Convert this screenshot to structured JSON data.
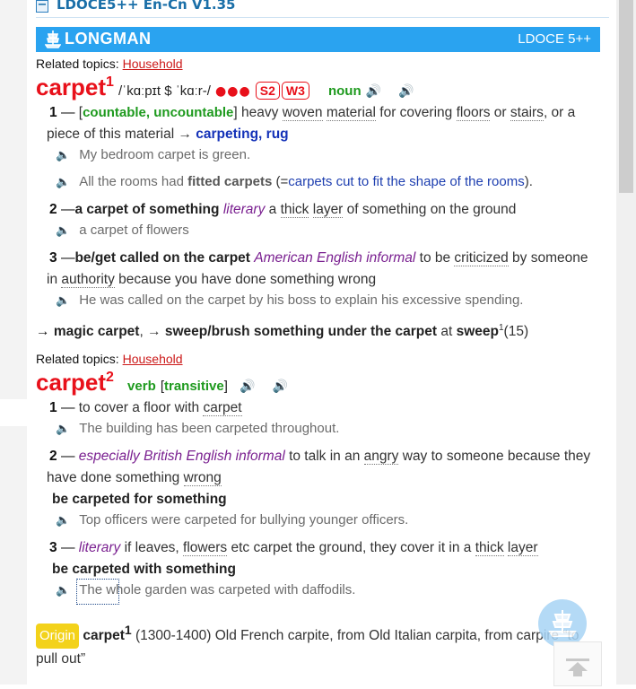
{
  "dict_title": "LDOCE5++ En-Cn V1.35",
  "toggle": "−",
  "banner": {
    "brand": "LONGMAN",
    "version": "LDOCE 5++"
  },
  "related_label": "Related topics:",
  "entry1": {
    "related_topic": "Household",
    "headword": "carpet",
    "hom": "1",
    "pron": "/ˈkɑːpɪt $ ˈkɑːr-/",
    "freq_dots": "●●●",
    "freq_s": "S2",
    "freq_w": "W3",
    "pos": "noun",
    "sense1": {
      "num": "1",
      "gram": "countable, uncountable",
      "pre": "heavy ",
      "w1": "woven",
      "mid1": " ",
      "w2": "material",
      "mid2": " for covering ",
      "w3": "floors",
      "mid3": " or ",
      "w4": "stairs",
      "tail": ", or a piece of this material → ",
      "xref1": "carpeting",
      "comma": ", ",
      "xref2": "rug"
    },
    "ex1": "My bedroom carpet is green.",
    "ex2_a": "All the rooms had ",
    "ex2_b": "fitted carpets",
    "ex2_c": " (=",
    "ex2_d": "carpets cut to fit the shape of the rooms",
    "ex2_e": ").",
    "sense2": {
      "num": "2",
      "phrase": "a carpet of something",
      "reg": "literary",
      "def_a": " a ",
      "w1": "thick",
      "def_b": " ",
      "w2": "layer",
      "def_c": " of something on the ground"
    },
    "ex3": "a carpet of flowers",
    "sense3": {
      "num": "3",
      "phrase": "be/get called on the carpet",
      "reg": "American English informal",
      "def_a": " to be ",
      "w1": "criticized",
      "def_b": " by someone in ",
      "w2": "authority",
      "def_c": " because you have done something wrong"
    },
    "ex4": "He was called on the carpet by his boss to explain his excessive spending.",
    "xref_line": {
      "p1": "magic carpet",
      "sep": ", → ",
      "p2": "sweep/brush something under the carpet",
      "at": " at ",
      "p3": "sweep",
      "sup": "1",
      "tail": "(15)"
    }
  },
  "entry2": {
    "related_topic": "Household",
    "headword": "carpet",
    "hom": "2",
    "pos": "verb",
    "gram": "transitive",
    "sense1": {
      "num": "1",
      "def_a": "to cover a floor with ",
      "w1": "carpet"
    },
    "ex1": "The building has been carpeted throughout.",
    "sense2": {
      "num": "2",
      "reg": "especially British English informal",
      "def_a": " to talk in an ",
      "w1": "angry",
      "def_b": " way to someone because they have done something ",
      "w2": "wrong"
    },
    "phrase2": "be carpeted for something",
    "ex2": "Top officers were carpeted for bullying younger officers.",
    "sense3": {
      "num": "3",
      "reg": "literary",
      "def_a": " if leaves, ",
      "w1": "flowers",
      "def_b": " etc carpet the ground, they cover it in a ",
      "w2": "thick",
      "def_c": " ",
      "w3": "layer"
    },
    "phrase3": "be carpeted with something",
    "ex3": "The whole garden was carpeted with daffodils."
  },
  "origin": {
    "badge": "Origin",
    "word": "carpet",
    "sup": "1",
    "text": " (1300-1400) Old French carpite, from Old Italian carpita, from carpire “to pull out”"
  },
  "colors": {
    "banner": "#2aa3f0",
    "headword": "#e8101a",
    "pos": "#1e9a1e",
    "xref": "#1432b8",
    "register": "#7a2090",
    "origin": "#f3d21a"
  }
}
